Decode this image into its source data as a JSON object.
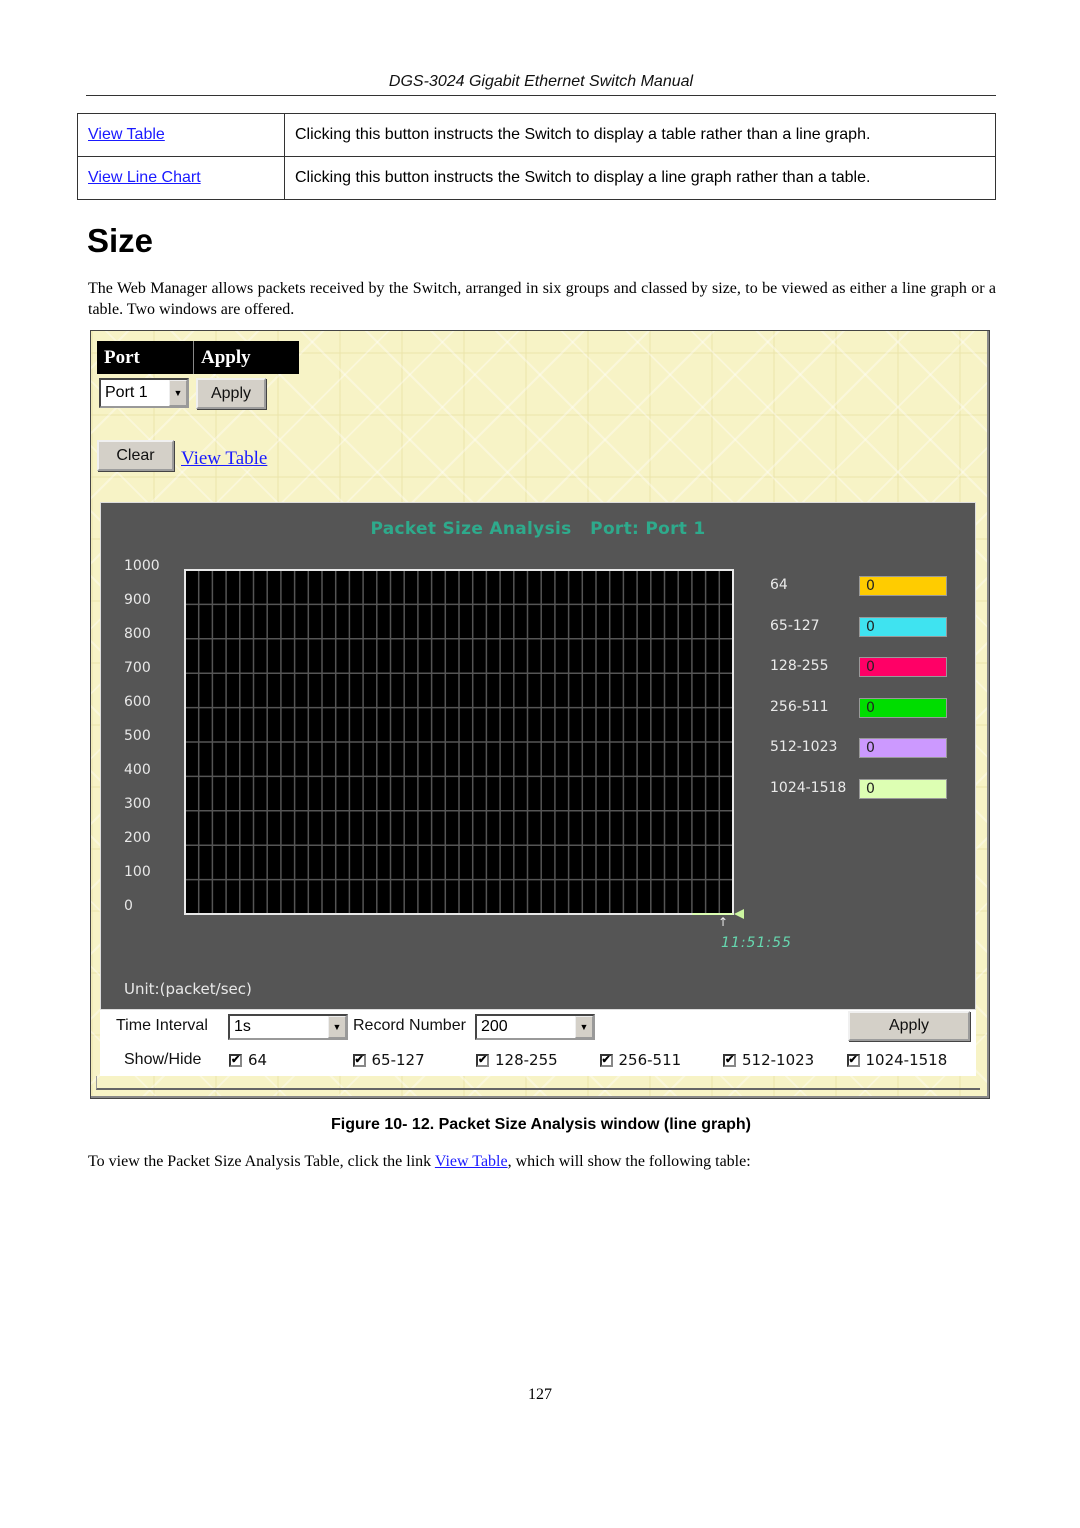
{
  "header": {
    "title": "DGS-3024 Gigabit Ethernet Switch Manual"
  },
  "definition_table": [
    {
      "term": "View Table",
      "description": "Clicking this button instructs the Switch to display a table rather than a line graph."
    },
    {
      "term": "View Line Chart",
      "description": "Clicking this button instructs the Switch to display a line graph rather than a table."
    }
  ],
  "section": {
    "title": "Size",
    "intro": "The Web Manager allows packets received by the Switch, arranged in six groups and classed by size, to be viewed as either a line graph or a table. Two windows are offered."
  },
  "screenshot": {
    "port_header": "Port",
    "apply_header": "Apply",
    "port_select": "Port 1",
    "apply_button": "Apply",
    "clear_button": "Clear",
    "view_table_link": "View Table",
    "chart": {
      "title": "Packet Size Analysis   Port: Port 1",
      "unit": "Unit:(packet/sec)",
      "timestamp": "11:51:55",
      "colors": {
        "plot_bg": "#000000",
        "panel_bg": "#555555",
        "title": "#2eaa8c",
        "timestamp": "#66d9b0"
      }
    },
    "controls": {
      "time_interval_label": "Time Interval",
      "time_interval_value": "1s",
      "record_number_label": "Record Number",
      "record_number_value": "200",
      "apply_button": "Apply",
      "show_hide_label": "Show/Hide",
      "checkboxes": [
        {
          "label": "64",
          "checked": true
        },
        {
          "label": "65-127",
          "checked": true
        },
        {
          "label": "128-255",
          "checked": true
        },
        {
          "label": "256-511",
          "checked": true
        },
        {
          "label": "512-1023",
          "checked": true
        },
        {
          "label": "1024-1518",
          "checked": true
        }
      ]
    }
  },
  "chart_data": {
    "type": "line",
    "title": "Packet Size Analysis   Port: Port 1",
    "ylabel": "Unit:(packet/sec)",
    "xlabel": "",
    "ylim": [
      0,
      1000
    ],
    "y_ticks": [
      "1000",
      "900",
      "800",
      "700",
      "600",
      "500",
      "400",
      "300",
      "200",
      "100",
      "0"
    ],
    "x_tick_labels": [
      "11:51:55"
    ],
    "grid": true,
    "legend_position": "right",
    "series": [
      {
        "name": "64",
        "color": "#ffcc00",
        "current_value": 0,
        "values": [
          0
        ]
      },
      {
        "name": "65-127",
        "color": "#3fe3f0",
        "current_value": 0,
        "values": [
          0
        ]
      },
      {
        "name": "128-255",
        "color": "#ff0066",
        "current_value": 0,
        "values": [
          0
        ]
      },
      {
        "name": "256-511",
        "color": "#00dd00",
        "current_value": 0,
        "values": [
          0
        ]
      },
      {
        "name": "512-1023",
        "color": "#cc99ff",
        "current_value": 0,
        "values": [
          0
        ]
      },
      {
        "name": "1024-1518",
        "color": "#ddffb3",
        "current_value": 0,
        "values": [
          0
        ]
      }
    ]
  },
  "figure_caption": "Figure 10- 12. Packet Size Analysis window (line graph)",
  "follow_text": {
    "before": "To view the Packet Size Analysis Table, click the link ",
    "link": "View Table",
    "after": ", which will show the following table:"
  },
  "page_number": "127"
}
